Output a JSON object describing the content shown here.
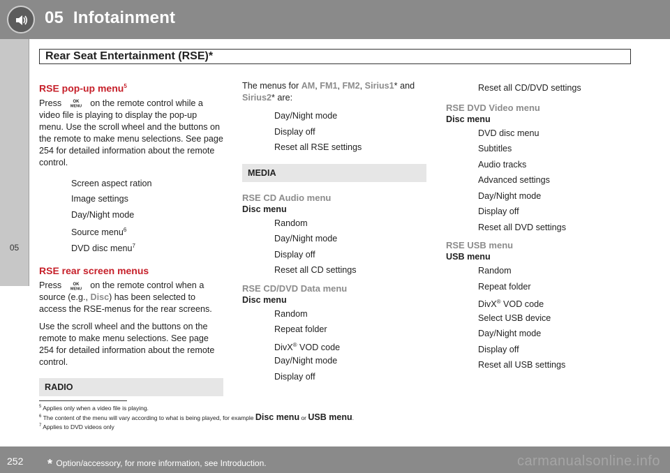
{
  "header": {
    "chapter": "05",
    "title": "Infotainment"
  },
  "section_title": "Rear Seat Entertainment (RSE)*",
  "side_tab": "05",
  "col1": {
    "popup_heading": "RSE pop-up menu",
    "popup_sup": "5",
    "popup_para_a": "Press",
    "popup_para_b": "on the remote control while a video file is playing to display the pop-up menu. Use the scroll wheel and the buttons on the remote to make menu selections. See page 254 for detailed information about the remote control.",
    "popup_items": [
      "Screen aspect ration",
      "Image settings",
      "Day/Night mode"
    ],
    "source_menu": "Source menu",
    "source_sup": "6",
    "dvd_disc_menu": "DVD disc menu",
    "dvd_sup": "7",
    "rear_heading": "RSE rear screen menus",
    "rear_para_a": "Press",
    "rear_para_b": "on the remote control when a source (e.g.,",
    "rear_disc": "Disc",
    "rear_para_c": ") has been selected to access the RSE-menus for the rear screens.",
    "rear_para2": "Use the scroll wheel and the buttons on the remote to make menu selections. See page 254 for detailed information about the remote control.",
    "radio_box": "RADIO",
    "ok_button_icon": "ok-menu-button-icon"
  },
  "col2": {
    "intro_a": "The menus for",
    "am": "AM",
    "fm1": "FM1",
    "fm2": "FM2",
    "sirius1": "Sirius1",
    "and": "* and",
    "sirius2": "Sirius2",
    "are": "* are:",
    "radio_items": [
      "Day/Night mode",
      "Display off",
      "Reset all RSE settings"
    ],
    "media_box": "MEDIA",
    "cd_heading": "RSE CD Audio menu",
    "cd_sub": "Disc menu",
    "cd_items": [
      "Random",
      "Day/Night mode",
      "Display off",
      "Reset all CD settings"
    ],
    "data_heading": "RSE CD/DVD Data menu",
    "data_sub": "Disc menu",
    "data_items_a": [
      "Random",
      "Repeat folder"
    ],
    "divx": "DivX",
    "reg": "®",
    "vod": "VOD code",
    "data_items_b": [
      "Day/Night mode",
      "Display off"
    ]
  },
  "col3": {
    "top_item": "Reset all CD/DVD settings",
    "dvd_heading": "RSE DVD Video menu",
    "dvd_sub": "Disc menu",
    "dvd_items": [
      "DVD disc menu",
      "Subtitles",
      "Audio tracks",
      "Advanced settings",
      "Day/Night mode",
      "Display off",
      "Reset all DVD settings"
    ],
    "usb_heading": "RSE USB menu",
    "usb_sub": "USB menu",
    "usb_items_a": [
      "Random",
      "Repeat folder"
    ],
    "divx": "DivX",
    "reg": "®",
    "vod": "VOD code",
    "usb_items_b": [
      "Select USB device",
      "Day/Night mode",
      "Display off",
      "Reset all USB settings"
    ]
  },
  "footnotes": {
    "fn5_num": "5",
    "fn5": "Applies only when a video file is playing.",
    "fn6_num": "6",
    "fn6_a": "The content of the menu will vary according to what is being played, for example",
    "fn6_disc": "Disc menu",
    "fn6_or": "or",
    "fn6_usb": "USB menu",
    "fn6_end": ".",
    "fn7_num": "7",
    "fn7": "Applies to DVD videos only"
  },
  "footer": {
    "page_number": "252",
    "star": "*",
    "note": "Option/accessory, for more information, see Introduction.",
    "watermark": "carmanualsonline.info"
  },
  "colors": {
    "header_gray": "#8a8a8a",
    "heading_red": "#c6202a",
    "subheading_gray": "#8c8c8c",
    "box_gray": "#e6e6e6"
  }
}
